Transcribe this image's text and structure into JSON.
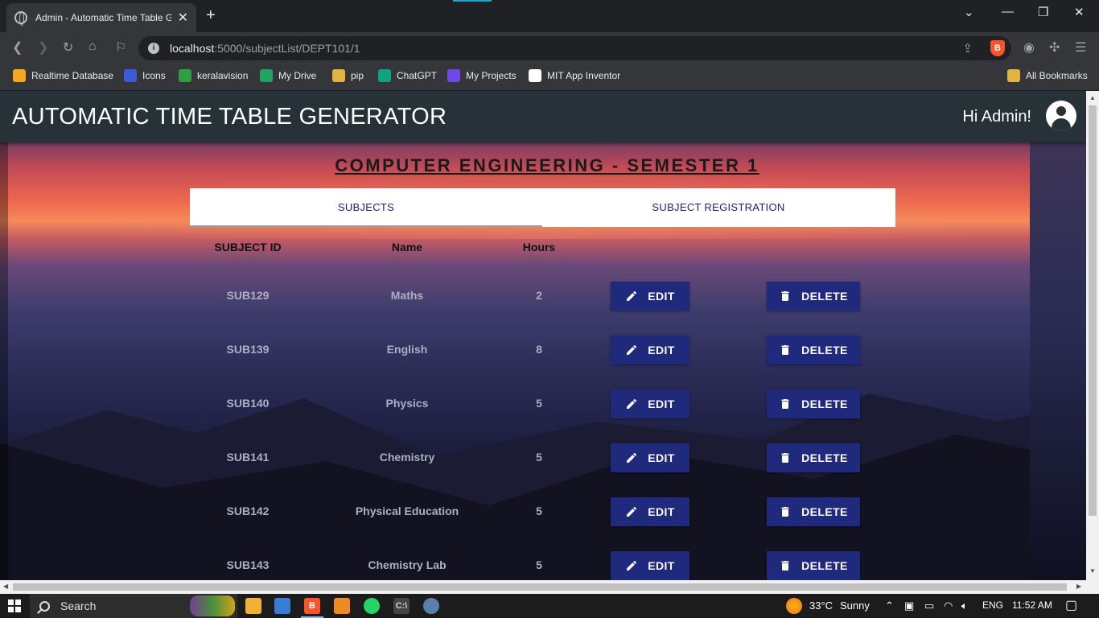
{
  "browser": {
    "tab_title": "Admin - Automatic Time Table G",
    "url_host": "localhost",
    "url_rest": ":5000/subjectList/DEPT101/1",
    "bookmarks": [
      {
        "label": "Realtime Database",
        "icon": "firebase-icon",
        "color": "#f5a623"
      },
      {
        "label": "Icons",
        "icon": "icons-icon",
        "color": "#3b5bdb"
      },
      {
        "label": "keralavision",
        "icon": "keralavision-icon",
        "color": "#2f9e44"
      },
      {
        "label": "My Drive",
        "icon": "google-drive-icon",
        "color": "#1fa463"
      },
      {
        "label": "pip",
        "icon": "folder-icon",
        "color": "#e3b341"
      },
      {
        "label": "ChatGPT",
        "icon": "chatgpt-icon",
        "color": "#10a37f"
      },
      {
        "label": "My Projects",
        "icon": "projects-icon",
        "color": "#7048e8"
      },
      {
        "label": "MIT App Inventor",
        "icon": "google-icon",
        "color": "#ffffff"
      }
    ],
    "all_bookmarks": "All Bookmarks"
  },
  "app": {
    "brand": "AUTOMATIC TIME TABLE GENERATOR",
    "greeting": "Hi Admin!",
    "accent_color": "#1f2a7c",
    "navbar_color": "#263238"
  },
  "page": {
    "title": "COMPUTER ENGINEERING - SEMESTER 1",
    "tabs": [
      {
        "label": "SUBJECTS",
        "active": true
      },
      {
        "label": "SUBJECT REGISTRATION",
        "active": false
      }
    ],
    "columns": [
      "SUBJECT ID",
      "Name",
      "Hours"
    ],
    "edit_label": "EDIT",
    "delete_label": "DELETE",
    "rows": [
      {
        "id": "SUB129",
        "name": "Maths",
        "hours": "2"
      },
      {
        "id": "SUB139",
        "name": "English",
        "hours": "8"
      },
      {
        "id": "SUB140",
        "name": "Physics",
        "hours": "5"
      },
      {
        "id": "SUB141",
        "name": "Chemistry",
        "hours": "5"
      },
      {
        "id": "SUB142",
        "name": "Physical Education",
        "hours": "5"
      },
      {
        "id": "SUB143",
        "name": "Chemistry Lab",
        "hours": "5"
      }
    ]
  },
  "taskbar": {
    "search_placeholder": "Search",
    "weather_temp": "33°C",
    "weather_text": "Sunny",
    "language": "ENG",
    "time": "11:52 AM"
  }
}
